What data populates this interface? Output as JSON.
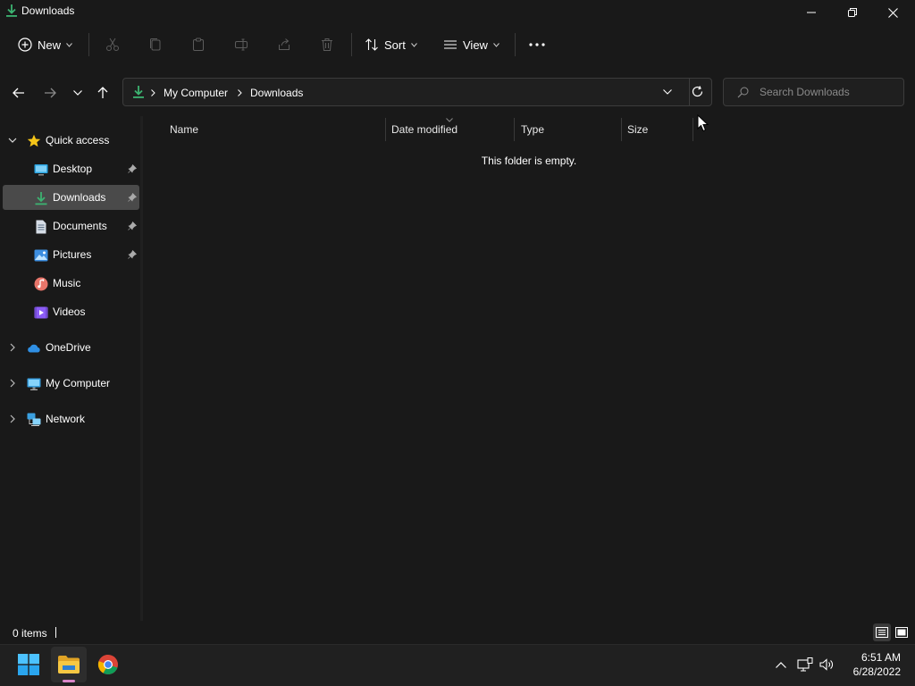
{
  "window": {
    "title": "Downloads",
    "controls": [
      "minimize-icon",
      "restore-icon",
      "close-icon"
    ]
  },
  "toolbar": {
    "new_label": "New",
    "sort_label": "Sort",
    "view_label": "View",
    "icons": [
      "cut-icon",
      "copy-icon",
      "paste-icon",
      "rename-icon",
      "share-icon",
      "delete-icon",
      "more-icon"
    ]
  },
  "navigation": {
    "breadcrumb": [
      "My Computer",
      "Downloads"
    ],
    "search_placeholder": "Search Downloads"
  },
  "sidebar": {
    "quick_access_label": "Quick access",
    "quick_access_items": [
      {
        "label": "Desktop",
        "icon": "desktop-icon",
        "pinned": true
      },
      {
        "label": "Downloads",
        "icon": "downloads-icon",
        "pinned": true,
        "selected": true
      },
      {
        "label": "Documents",
        "icon": "documents-icon",
        "pinned": true
      },
      {
        "label": "Pictures",
        "icon": "pictures-icon",
        "pinned": true
      },
      {
        "label": "Music",
        "icon": "music-icon",
        "pinned": false
      },
      {
        "label": "Videos",
        "icon": "videos-icon",
        "pinned": false
      }
    ],
    "roots": [
      {
        "label": "OneDrive",
        "icon": "onedrive-icon"
      },
      {
        "label": "My Computer",
        "icon": "computer-icon"
      },
      {
        "label": "Network",
        "icon": "network-icon"
      }
    ]
  },
  "file_list": {
    "columns": [
      "Name",
      "Date modified",
      "Type",
      "Size"
    ],
    "empty_message": "This folder is empty."
  },
  "status": {
    "item_count": "0 items"
  },
  "taskbar": {
    "apps": [
      "start-icon",
      "file-explorer-icon",
      "chrome-icon"
    ],
    "time": "6:51 AM",
    "date": "6/28/2022"
  },
  "colors": {
    "background": "#191919",
    "selection": "#4a4a4a",
    "download_accent": "#3cb371",
    "taskbar": "#202020"
  }
}
